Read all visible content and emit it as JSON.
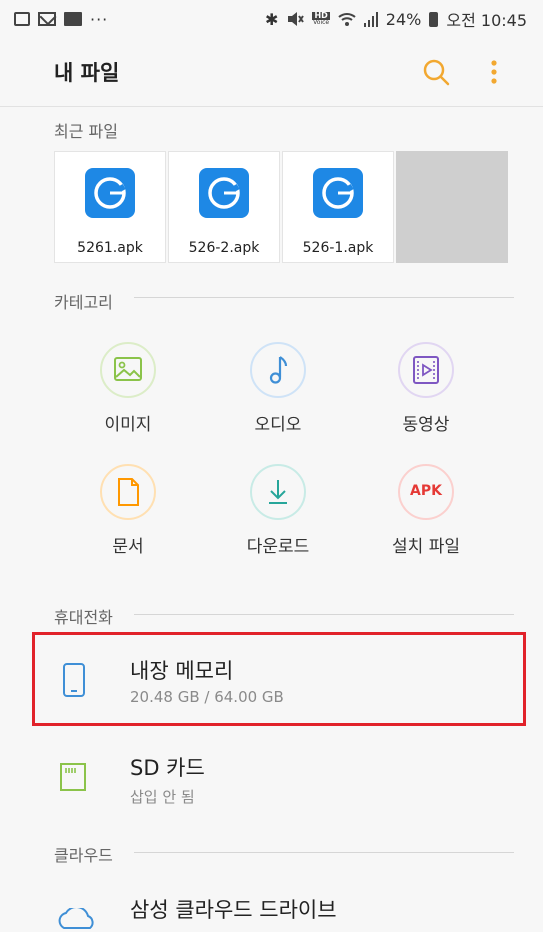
{
  "status_bar": {
    "dots": "···",
    "bluetooth": "✱",
    "volte_top": "HD",
    "volte_bottom": "Voice",
    "signal_icon": "signal-icon",
    "battery_pct": "24%",
    "time": "오전 10:45"
  },
  "header": {
    "title": "내 파일"
  },
  "recent": {
    "label": "최근 파일",
    "files": [
      {
        "name": "5261.apk"
      },
      {
        "name": "526-2.apk"
      },
      {
        "name": "526-1.apk"
      }
    ]
  },
  "categories": {
    "label": "카테고리",
    "items": [
      {
        "label": "이미지",
        "icon": "image-icon",
        "color": "#8bc34a"
      },
      {
        "label": "오디오",
        "icon": "audio-icon",
        "color": "#3f8fd6"
      },
      {
        "label": "동영상",
        "icon": "video-icon",
        "color": "#7e57c2"
      },
      {
        "label": "문서",
        "icon": "document-icon",
        "color": "#ff9800"
      },
      {
        "label": "다운로드",
        "icon": "download-icon",
        "color": "#26a69a"
      },
      {
        "label": "설치 파일",
        "icon": "apk-icon",
        "icon_text": "APK",
        "color": "#e53935"
      }
    ]
  },
  "phone": {
    "label": "휴대전화",
    "internal": {
      "title": "내장 메모리",
      "sub": "20.48 GB / 64.00 GB",
      "icon_color": "#3f8fd6"
    },
    "sd": {
      "title": "SD 카드",
      "sub": "삽입 안 됨",
      "icon_color": "#8bc34a"
    }
  },
  "cloud": {
    "label": "클라우드",
    "samsung": {
      "title": "삼성 클라우드 드라이브"
    }
  },
  "colors": {
    "accent": "#f2a830",
    "highlight": "#e1222a"
  }
}
